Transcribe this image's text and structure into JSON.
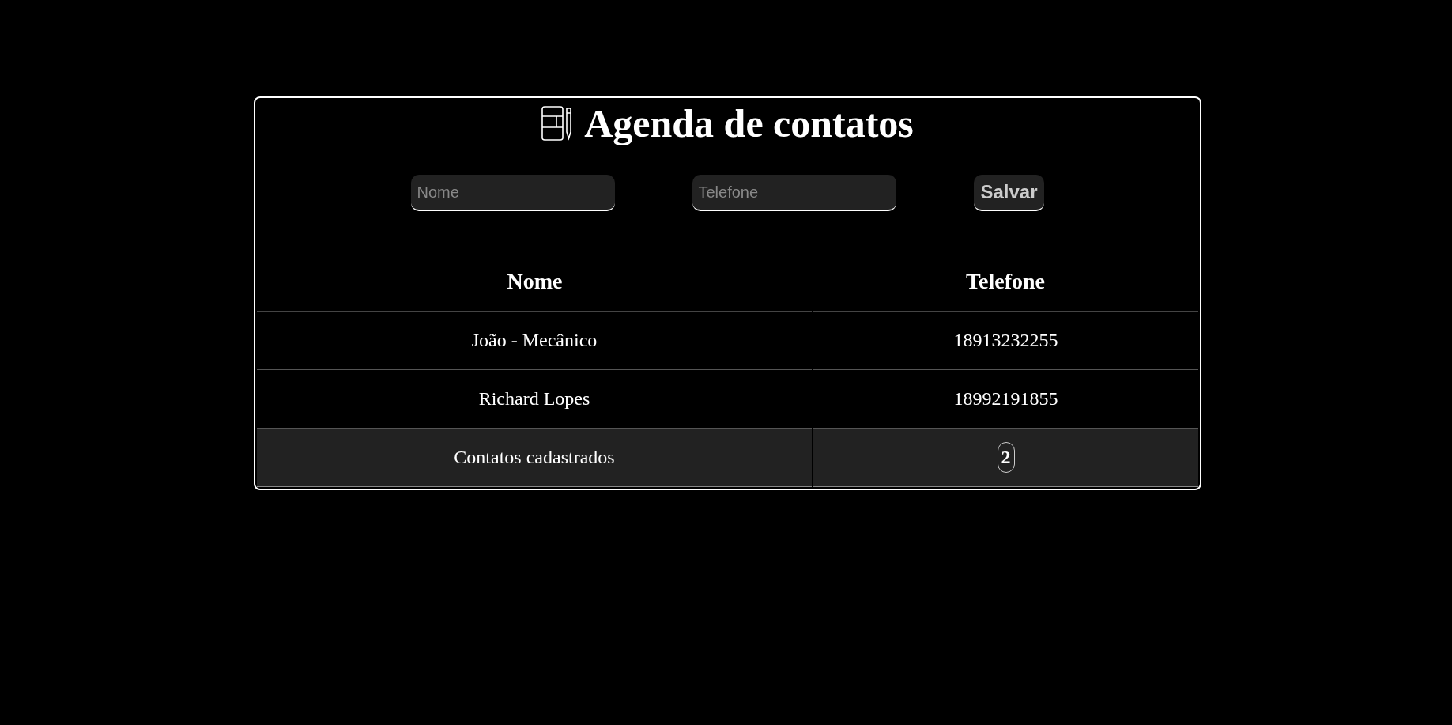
{
  "title": "Agenda de contatos",
  "form": {
    "name_field": {
      "placeholder": "Nome"
    },
    "phone_field": {
      "placeholder": "Telefone"
    },
    "save_button": "Salvar"
  },
  "table": {
    "columns": [
      "Nome",
      "Telefone"
    ],
    "rows": [
      {
        "name": "João - Mecânico",
        "phone": "18913232255"
      },
      {
        "name": "Richard Lopes",
        "phone": "18992191855"
      }
    ],
    "footer": {
      "label": "Contatos cadastrados",
      "count": "2"
    }
  }
}
